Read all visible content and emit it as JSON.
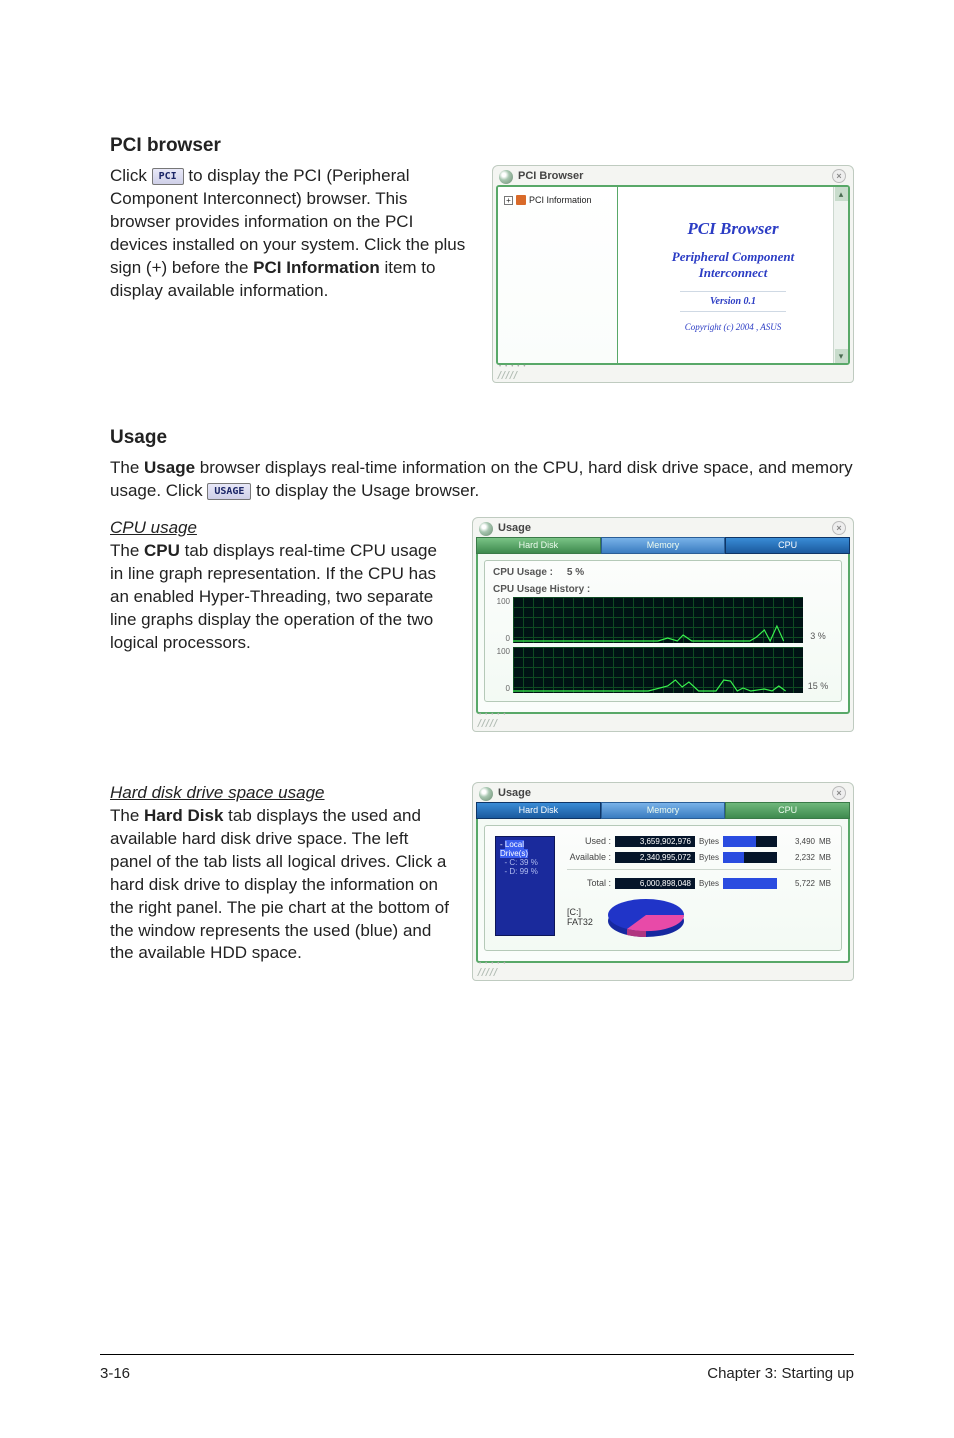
{
  "pci_section": {
    "heading": "PCI browser",
    "para_pre": "Click ",
    "btn": "PCI",
    "para_post": " to display the PCI (Peripheral Component Interconnect) browser. This browser provides information on the PCI devices installed on your system. Click the plus sign (+) before the ",
    "bold": "PCI Information",
    "para_end": " item to display available information.",
    "win": {
      "title": "PCI Browser",
      "tree_label": "PCI Information",
      "h": "PCI  Browser",
      "sub1": "Peripheral Component",
      "sub2": "Interconnect",
      "ver": "Version 0.1",
      "copy": "Copyright (c) 2004 ,  ASUS"
    }
  },
  "usage_section": {
    "heading": "Usage",
    "intro_pre": "The ",
    "intro_bold": "Usage",
    "intro_mid": " browser displays real-time information on the CPU, hard disk drive space, and memory usage. Click ",
    "btn": "USAGE",
    "intro_end": " to display the Usage browser.",
    "cpu": {
      "subhead": "CPU usage",
      "para_pre": "The ",
      "para_bold": "CPU",
      "para_post": " tab displays real-time CPU usage in line graph representation. If the CPU has an enabled Hyper-Threading, two separate line graphs display the operation of the two logical processors.",
      "win": {
        "title": "Usage",
        "tab_hd": "Hard Disk",
        "tab_mem": "Memory",
        "tab_cpu": "CPU",
        "label_usage": "CPU Usage :",
        "value_usage": "5   %",
        "label_history": "CPU Usage History :",
        "y_top": "100",
        "y_bot": "0",
        "g1_pct": "3 %",
        "g2_pct": "15 %"
      }
    },
    "hd": {
      "subhead": "Hard disk drive space usage",
      "para_pre": "The ",
      "para_bold": "Hard Disk",
      "para_post": " tab displays the used and available hard disk drive space. The left panel of the tab lists all logical drives. Click a hard disk drive to display the information on the right panel. The pie chart at the bottom of the window represents the used (blue) and the available HDD space.",
      "win": {
        "title": "Usage",
        "tab_hd": "Hard Disk",
        "tab_mem": "Memory",
        "tab_cpu": "CPU",
        "tree_root": "Local Drive(s)",
        "tree_c": "C:  39 %",
        "tree_d": "D:  99 %",
        "used_label": "Used :",
        "used_num": "3,659,902,976",
        "used_mb": "3,490",
        "avail_label": "Available :",
        "avail_num": "2,340,995,072",
        "avail_mb": "2,232",
        "total_label": "Total :",
        "total_num": "6,000,898,048",
        "total_mb": "5,722",
        "bytes": "Bytes",
        "mb": "MB",
        "pie_label1": "[C:]",
        "pie_label2": "FAT32"
      }
    }
  },
  "chart_data": [
    {
      "type": "line",
      "title": "CPU Usage History (logical processor 1)",
      "ylim": [
        0,
        100
      ],
      "current_pct": 3,
      "values": [
        2,
        2,
        2,
        1,
        2,
        2,
        2,
        1,
        2,
        2,
        2,
        2,
        2,
        1,
        2,
        2,
        2,
        2,
        2,
        8,
        1,
        14,
        2,
        2,
        2,
        2,
        2,
        3,
        2,
        2,
        2,
        3,
        10,
        25,
        3,
        36,
        3
      ],
      "color": "#39f24e"
    },
    {
      "type": "line",
      "title": "CPU Usage History (logical processor 2)",
      "ylim": [
        0,
        100
      ],
      "current_pct": 15,
      "values": [
        2,
        2,
        2,
        2,
        2,
        2,
        2,
        2,
        2,
        2,
        2,
        2,
        2,
        2,
        2,
        2,
        2,
        2,
        2,
        12,
        25,
        8,
        20,
        2,
        2,
        2,
        25,
        22,
        2,
        8,
        2,
        2,
        2,
        5,
        2,
        12,
        2
      ],
      "color": "#39f24e"
    },
    {
      "type": "pie",
      "title": "[C:] FAT32",
      "series": [
        {
          "name": "Used",
          "value": 3659902976,
          "color": "#2034c8"
        },
        {
          "name": "Available",
          "value": 2340995072,
          "color": "#e84aa8"
        }
      ]
    }
  ],
  "footer": {
    "left": "3-16",
    "right": "Chapter 3: Starting up"
  }
}
